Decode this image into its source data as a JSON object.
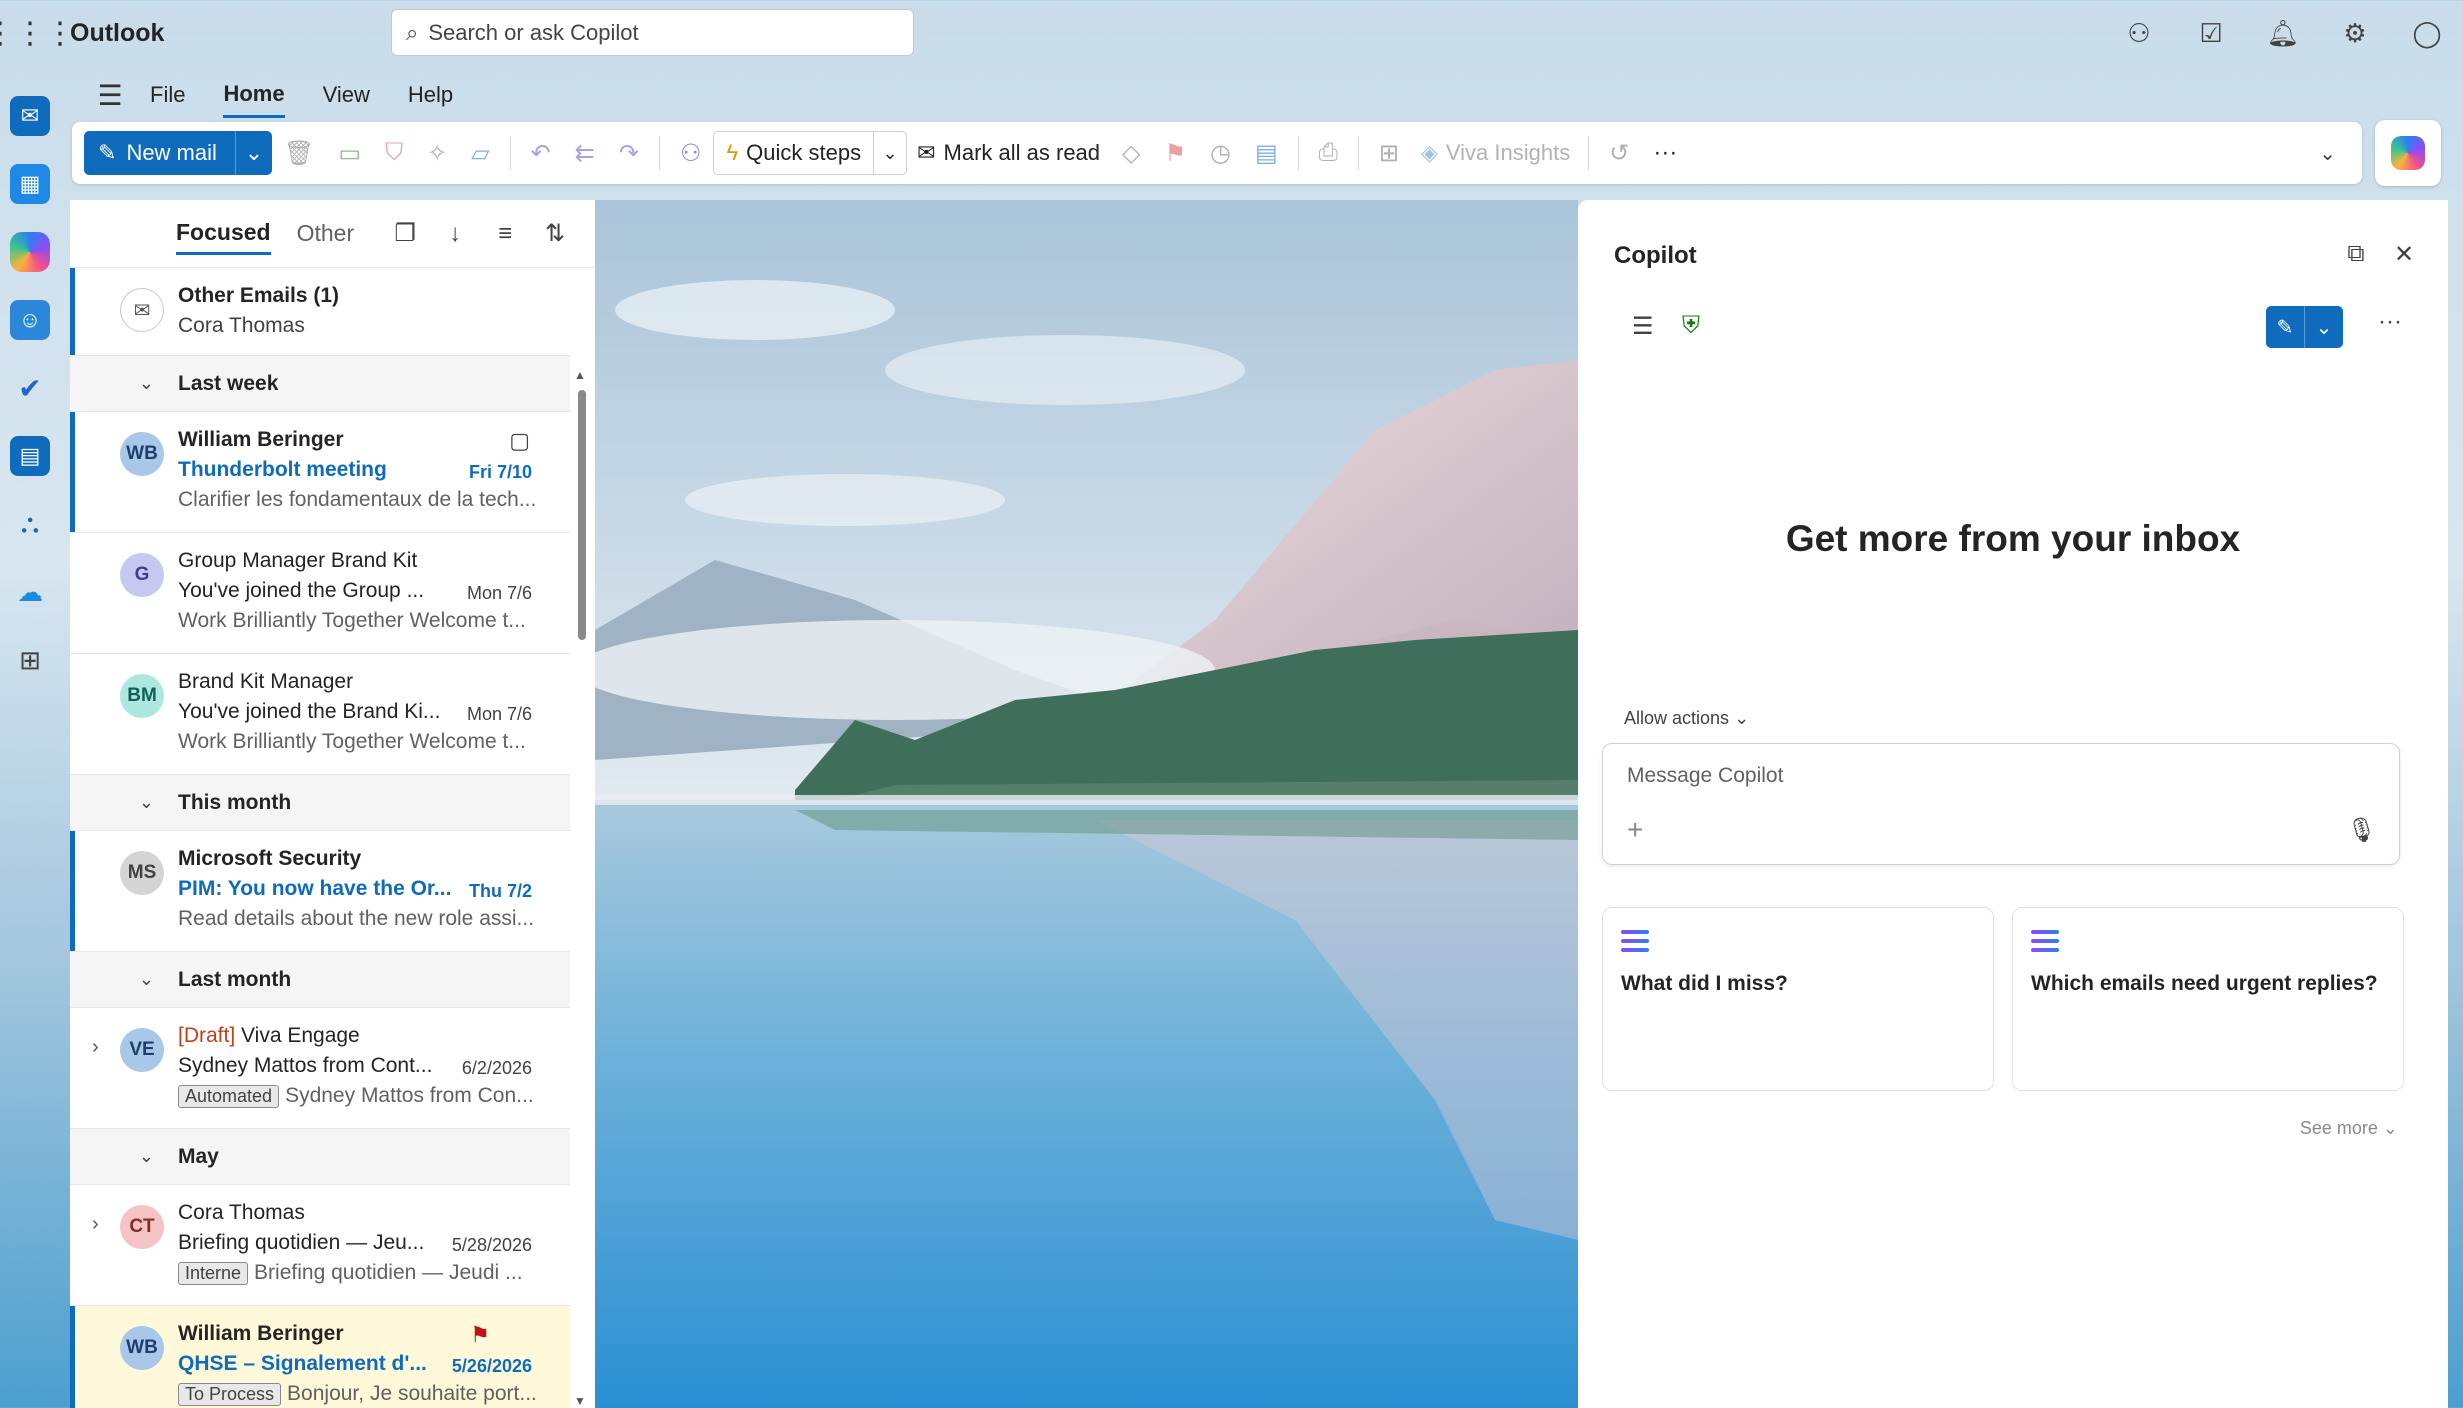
{
  "app": {
    "name": "Outlook"
  },
  "search": {
    "placeholder": "Search or ask Copilot"
  },
  "ribbon": {
    "tabs": [
      "File",
      "Home",
      "View",
      "Help"
    ],
    "active_tab": "Home",
    "new_mail": "New mail",
    "quick_steps": "Quick steps",
    "mark_all_read": "Mark all as read",
    "viva_insights": "Viva Insights"
  },
  "mail_list": {
    "pivots": {
      "focused": "Focused",
      "other": "Other"
    },
    "other_emails": {
      "title": "Other Emails (1)",
      "from": "Cora Thomas"
    },
    "groups": {
      "last_week": "Last week",
      "this_month": "This month",
      "last_month": "Last month",
      "may": "May"
    },
    "messages": [
      {
        "initials": "WB",
        "from": "William Beringer",
        "subject": "Thunderbolt meeting",
        "date": "Fri 7/10",
        "preview": "Clarifier les fondamentaux de la tech...",
        "unread": true,
        "avatar_color": "#a9c7e8"
      },
      {
        "initials": "G",
        "from": "Group Manager Brand Kit",
        "subject": "You've joined the Group ...",
        "date": "Mon 7/6",
        "preview": "Work Brilliantly Together Welcome t...",
        "unread": false,
        "avatar_color": "#c5c9f2"
      },
      {
        "initials": "BM",
        "from": "Brand Kit Manager",
        "subject": "You've joined the Brand Ki...",
        "date": "Mon 7/6",
        "preview": "Work Brilliantly Together Welcome t...",
        "unread": false,
        "avatar_color": "#aee6e0"
      },
      {
        "initials": "MS",
        "from": "Microsoft Security",
        "subject": "PIM: You now have the Or...",
        "date": "Thu 7/2",
        "preview": "Read details about the new role assi...",
        "unread": true,
        "avatar_color": "#d4d4d4"
      },
      {
        "initials": "VE",
        "draft": "[Draft]",
        "from": "Viva Engage",
        "subject": "Sydney Mattos from Cont...",
        "date": "6/2/2026",
        "tag": "Automated",
        "preview": "Sydney Mattos from Con...",
        "unread": false,
        "avatar_color": "#a9c7e8"
      },
      {
        "initials": "CT",
        "from": "Cora Thomas",
        "subject": "Briefing quotidien — Jeu...",
        "date": "5/28/2026",
        "tag": "Interne",
        "preview": "Briefing quotidien — Jeudi ...",
        "unread": false,
        "avatar_color": "#f4c3c3"
      },
      {
        "initials": "WB",
        "from": "William Beringer",
        "subject": "QHSE – Signalement d'...",
        "date": "5/26/2026",
        "tag": "To Process",
        "preview": "Bonjour, Je souhaite port...",
        "unread": true,
        "avatar_color": "#a9c7e8"
      }
    ]
  },
  "copilot": {
    "title": "Copilot",
    "heading": "Get more from your inbox",
    "allow_actions": "Allow actions",
    "message_placeholder": "Message Copilot",
    "suggestions": [
      "What did I miss?",
      "Which emails need urgent replies?"
    ],
    "see_more": "See more"
  },
  "colors": {
    "accent": "#0f6cbd",
    "flag": "#c50f1f",
    "draft": "#c43e1c",
    "flagged_row": "#fff9d9"
  }
}
